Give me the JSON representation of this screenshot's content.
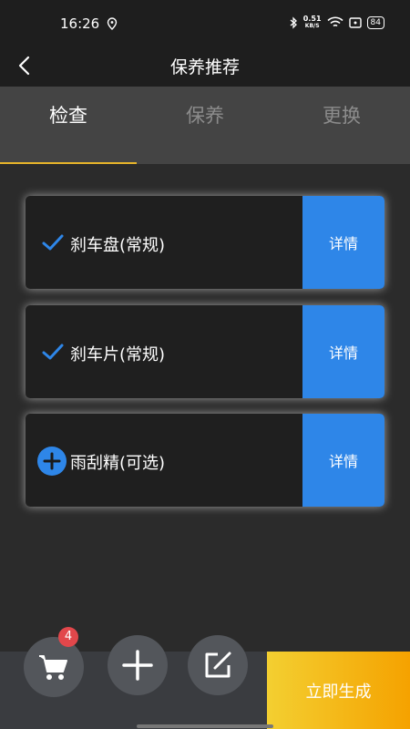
{
  "status_bar": {
    "time": "16:26",
    "speed_value": "0.51",
    "speed_unit": "KB/S",
    "battery": "84"
  },
  "header": {
    "title": "保养推荐"
  },
  "tabs": [
    {
      "label": "检查",
      "active": true
    },
    {
      "label": "保养",
      "active": false
    },
    {
      "label": "更换",
      "active": false
    }
  ],
  "items": [
    {
      "label": "刹车盘(常规)",
      "icon": "check-icon",
      "detail_label": "详情"
    },
    {
      "label": "刹车片(常规)",
      "icon": "check-icon",
      "detail_label": "详情"
    },
    {
      "label": "雨刮精(可选)",
      "icon": "plus-circle-icon",
      "detail_label": "详情"
    }
  ],
  "bottom": {
    "cart_badge": "4",
    "generate_label": "立即生成"
  },
  "colors": {
    "accent_blue": "#2e86e8",
    "tab_underline": "#e7b42a",
    "badge_red": "#e2474b"
  }
}
